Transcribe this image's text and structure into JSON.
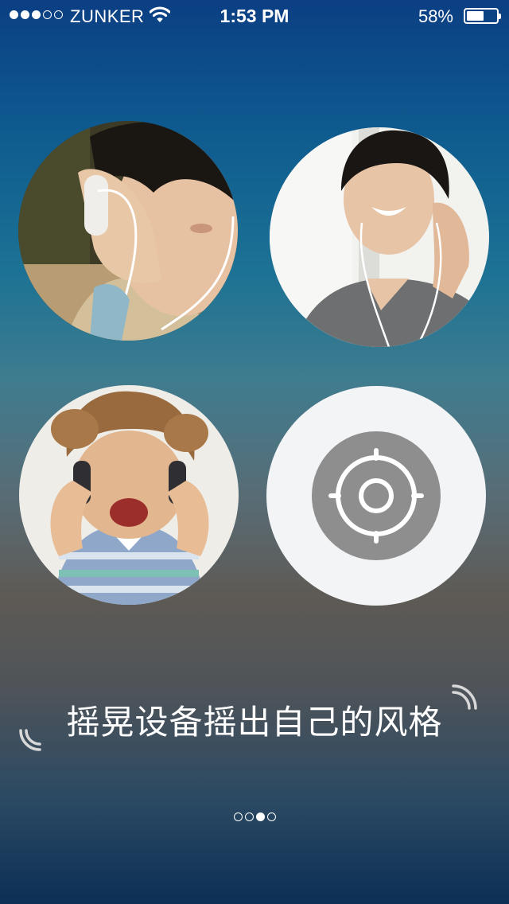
{
  "status_bar": {
    "signal_strength": 3,
    "signal_max": 5,
    "carrier": "ZUNKER",
    "time": "1:53 PM",
    "battery_percent": "58%",
    "battery_level": 0.58
  },
  "circles": [
    {
      "kind": "photo",
      "subject": "woman-with-headphones"
    },
    {
      "kind": "photo",
      "subject": "young-man-with-earphones"
    },
    {
      "kind": "photo",
      "subject": "toddler-with-headphones"
    },
    {
      "kind": "button",
      "icon": "locate-icon"
    }
  ],
  "tagline": "摇晃设备摇出自己的风格",
  "pager": {
    "total": 4,
    "active_index": 2
  },
  "colors": {
    "background_top": "#0b3f83",
    "background_mid": "#5e5a55",
    "background_bottom": "#0c2f55",
    "button_outer": "#f3f4f6",
    "button_inner": "#8e8e8e"
  }
}
